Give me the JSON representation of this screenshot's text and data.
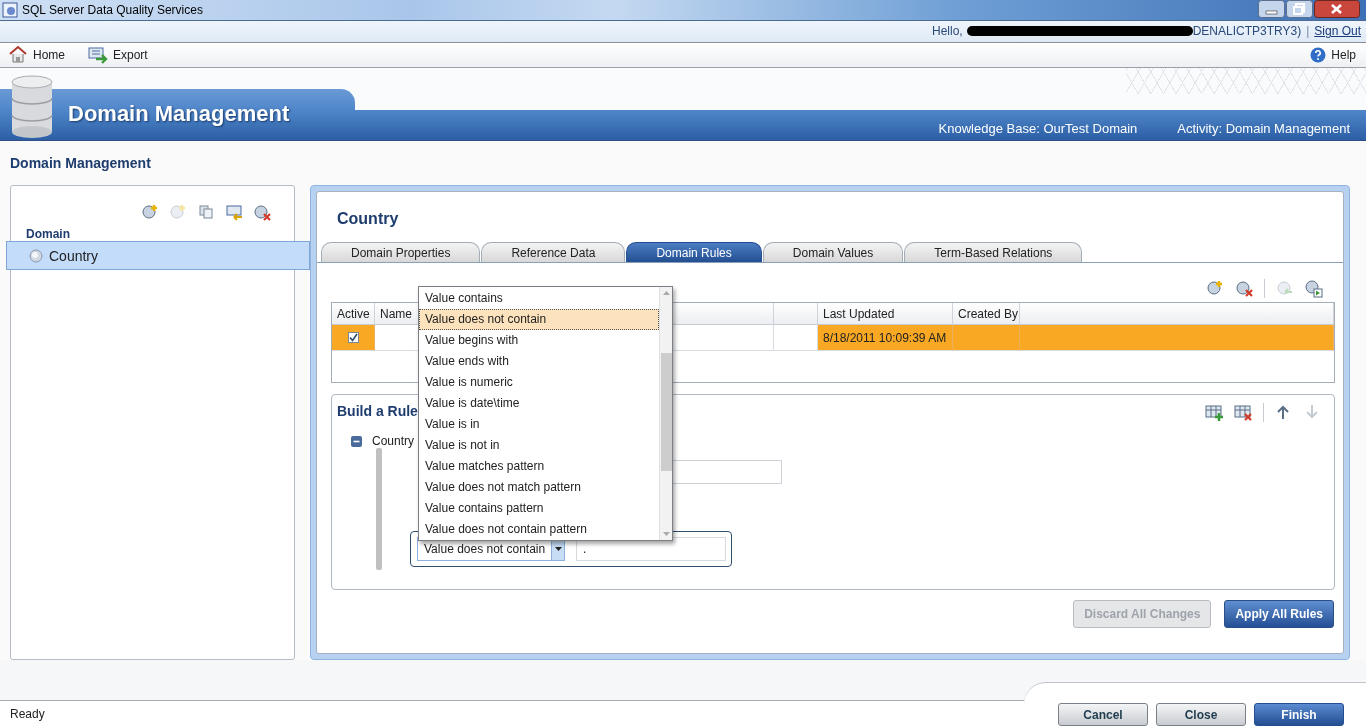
{
  "window": {
    "title": "SQL Server Data Quality Services"
  },
  "user_bar": {
    "greeting": "Hello,",
    "account_tail": "DENALICTP3TRY3)",
    "separator": "|",
    "sign_out": "Sign Out"
  },
  "toolbar": {
    "items": [
      {
        "kind": "home",
        "label": "Home"
      },
      {
        "kind": "export",
        "label": "Export"
      }
    ],
    "help": "Help"
  },
  "banner": {
    "title": "Domain Management",
    "knowledge_base": "Knowledge Base: OurTest Domain",
    "activity": "Activity: Domain Management"
  },
  "page_heading": "Domain Management",
  "domain_panel": {
    "tools": [
      {
        "kind": "add",
        "disabled": false
      },
      {
        "kind": "add",
        "disabled": true
      },
      {
        "kind": "copy",
        "disabled": false
      },
      {
        "kind": "import",
        "disabled": false
      },
      {
        "kind": "delete",
        "disabled": false
      }
    ],
    "heading": "Domain",
    "items": [
      {
        "label": "Country",
        "selected": true
      }
    ]
  },
  "domain": {
    "title": "Country",
    "tabs": [
      {
        "label": "Domain Properties",
        "selected": false
      },
      {
        "label": "Reference Data",
        "selected": false
      },
      {
        "label": "Domain Rules",
        "selected": true
      },
      {
        "label": "Domain Values",
        "selected": false
      },
      {
        "label": "Term-Based Relations",
        "selected": false
      }
    ],
    "rule_tools": [
      {
        "kind": "add",
        "disabled": false
      },
      {
        "kind": "delete",
        "disabled": false
      },
      {
        "kind": "sep"
      },
      {
        "kind": "back",
        "disabled": true
      },
      {
        "kind": "run",
        "disabled": false
      }
    ],
    "rules_table": {
      "columns": [
        "Active",
        "Name",
        "",
        "Last Updated",
        "Created By"
      ],
      "rows": [
        {
          "active": true,
          "selected": true,
          "name": "",
          "last_updated": "8/18/2011 10:09:39 AM",
          "created_by": ""
        }
      ]
    },
    "build": {
      "title": "Build a Rule",
      "tools": [
        {
          "kind": "add",
          "disabled": false
        },
        {
          "kind": "delete",
          "disabled": false
        },
        {
          "kind": "sep"
        },
        {
          "kind": "up",
          "disabled": false
        },
        {
          "kind": "down",
          "disabled": true
        }
      ],
      "node": {
        "label": "Country",
        "expanded": true
      },
      "condition": {
        "operator": "Value does not contain",
        "value": "."
      }
    },
    "dropdown": {
      "items": [
        {
          "label": "Value contains",
          "selected": false
        },
        {
          "label": "Value does not contain",
          "selected": true
        },
        {
          "label": "Value begins with",
          "selected": false
        },
        {
          "label": "Value ends with",
          "selected": false
        },
        {
          "label": "Value is numeric",
          "selected": false
        },
        {
          "label": "Value is date\\time",
          "selected": false
        },
        {
          "label": "Value is in",
          "selected": false
        },
        {
          "label": "Value is not in",
          "selected": false
        },
        {
          "label": "Value matches pattern",
          "selected": false
        },
        {
          "label": "Value does not match pattern",
          "selected": false
        },
        {
          "label": "Value contains pattern",
          "selected": false
        },
        {
          "label": "Value does not contain pattern",
          "selected": false
        }
      ]
    },
    "actions": [
      {
        "label": "Discard All Changes",
        "disabled": true
      },
      {
        "label": "Apply All Rules",
        "disabled": false
      }
    ]
  },
  "footer_buttons": [
    {
      "label": "Cancel",
      "primary": false
    },
    {
      "label": "Close",
      "primary": false
    },
    {
      "label": "Finish",
      "primary": true
    }
  ],
  "status_bar": "Ready"
}
